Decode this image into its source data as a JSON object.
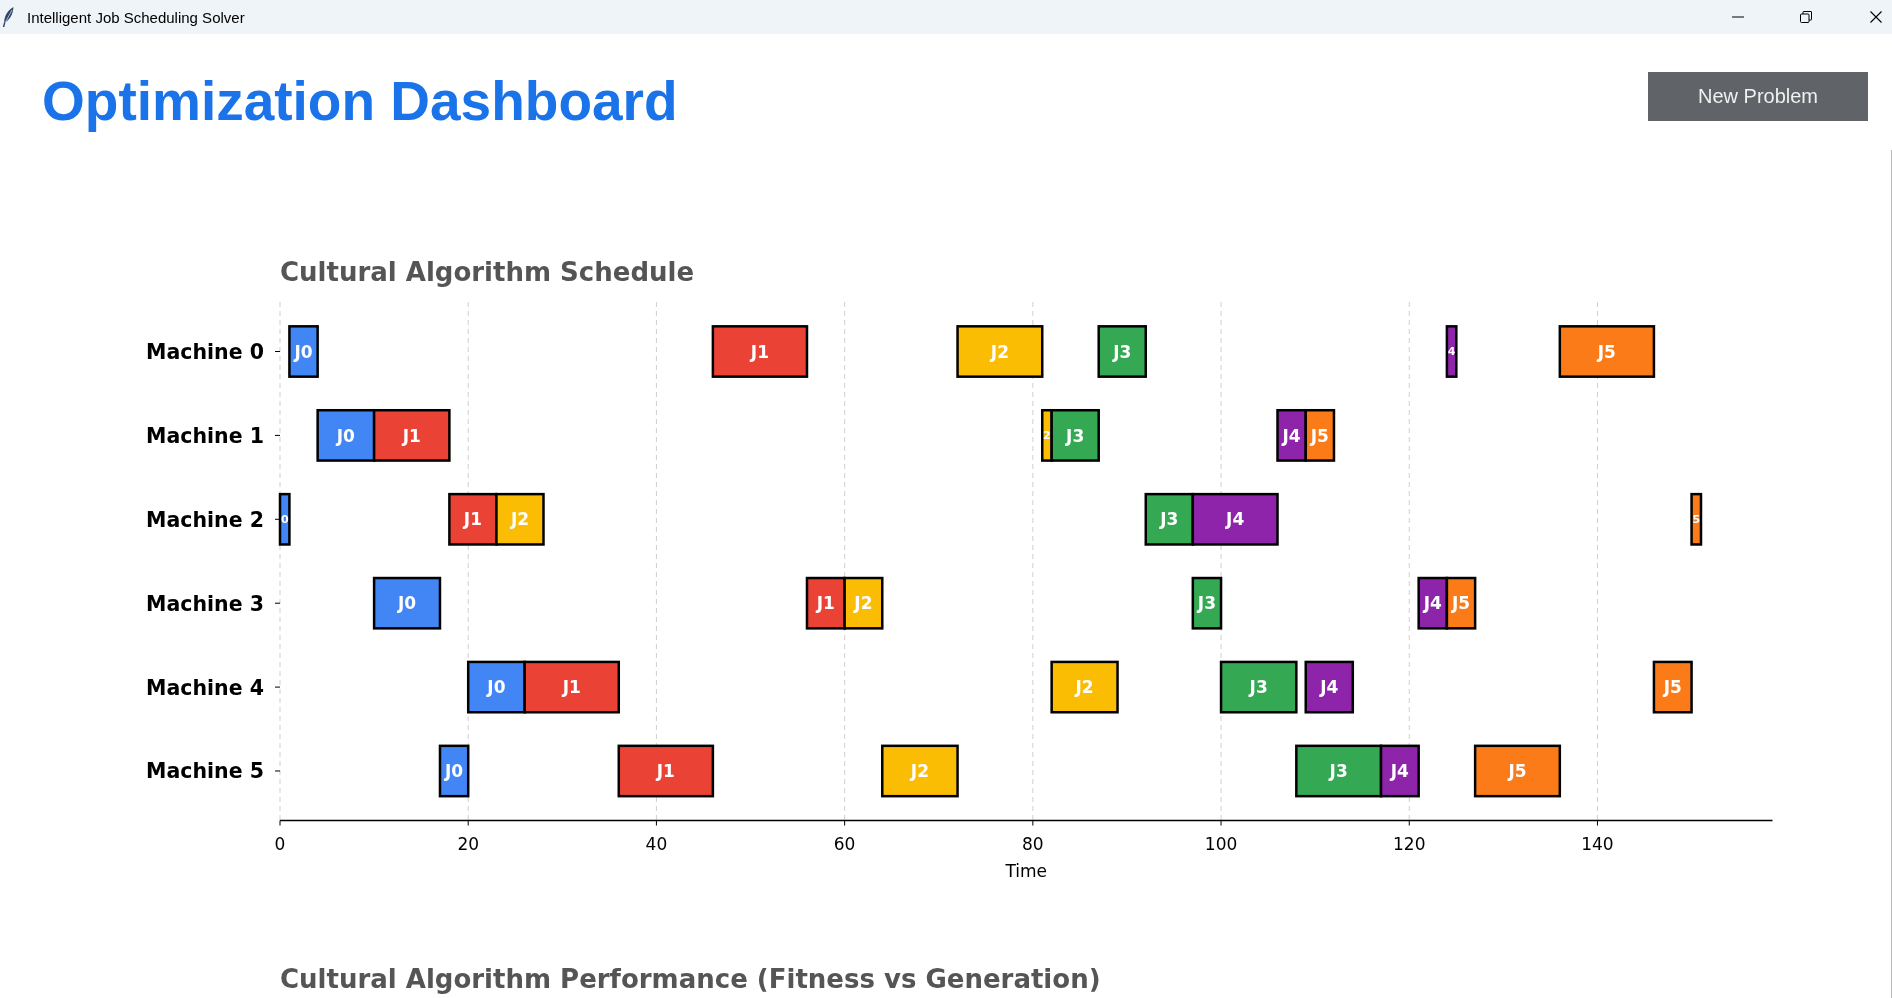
{
  "window": {
    "title": "Intelligent Job Scheduling Solver"
  },
  "header": {
    "title": "Optimization Dashboard",
    "button": "New Problem"
  },
  "schedule": {
    "chart_data": {
      "type": "bar",
      "orientation": "horizontal",
      "title": "Cultural Algorithm Schedule",
      "xlabel": "Time",
      "categories": [
        "Machine 0",
        "Machine 1",
        "Machine 2",
        "Machine 3",
        "Machine 4",
        "Machine 5"
      ],
      "xlim": [
        0,
        158.6
      ],
      "xticks": [
        0,
        20,
        40,
        60,
        80,
        100,
        120,
        140
      ],
      "grid": "x",
      "series": [
        {
          "color": "#4285f4",
          "base": [
            1,
            4,
            0,
            10,
            20,
            17
          ],
          "values": [
            3,
            6,
            1,
            7,
            6,
            3
          ],
          "value_labels": [
            "J0",
            "J0",
            null,
            "J0",
            "J0",
            "J0"
          ]
        },
        {
          "color": "#ea4335",
          "base": [
            46,
            10,
            18,
            56,
            26,
            36
          ],
          "values": [
            10,
            8,
            5,
            4,
            10,
            10
          ],
          "value_labels": [
            "J1",
            "J1",
            "J1",
            "J1",
            "J1",
            "J1"
          ]
        },
        {
          "color": "#fbbc04",
          "base": [
            72,
            81,
            23,
            60,
            82,
            64
          ],
          "values": [
            9,
            1,
            5,
            4,
            7,
            8
          ],
          "value_labels": [
            "J2",
            null,
            "J2",
            "J2",
            "J2",
            "J2"
          ]
        },
        {
          "color": "#34a853",
          "base": [
            87,
            82,
            92,
            97,
            100,
            108
          ],
          "values": [
            5,
            5,
            5,
            3,
            8,
            9
          ],
          "value_labels": [
            "J3",
            "J3",
            "J3",
            "J3",
            "J3",
            "J3"
          ]
        },
        {
          "color": "#8e24aa",
          "base": [
            124,
            106,
            97,
            121,
            109,
            117
          ],
          "values": [
            1,
            3,
            9,
            3,
            5,
            4
          ],
          "value_labels": [
            null,
            "J4",
            "J4",
            "J4",
            "J4",
            "J4"
          ]
        },
        {
          "color": "#fa7b17",
          "base": [
            136,
            109,
            150,
            124,
            146,
            127
          ],
          "values": [
            10,
            3,
            1,
            3,
            4,
            9
          ],
          "value_labels": [
            "J5",
            "J5",
            null,
            "J5",
            "J5",
            "J5"
          ]
        }
      ],
      "annotations": [
        "0",
        "2",
        "4",
        "5"
      ]
    }
  },
  "performance": {
    "title": "Cultural Algorithm Performance (Fitness vs Generation)"
  }
}
